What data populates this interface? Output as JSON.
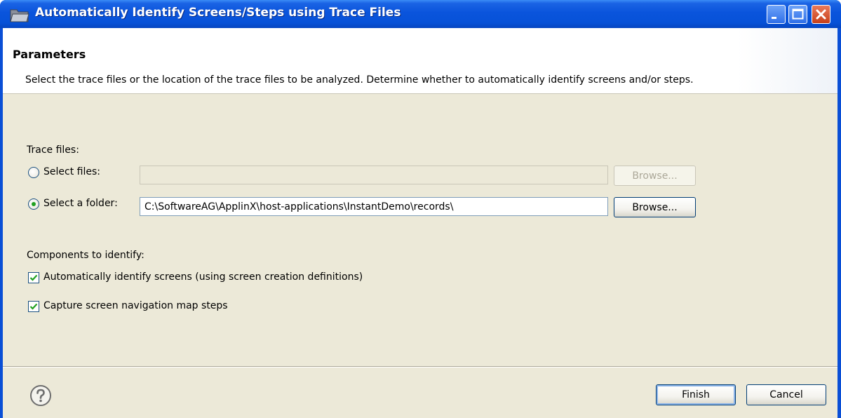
{
  "window": {
    "title": "Automatically Identify Screens/Steps using Trace Files",
    "colors": {
      "titlebar": "#0752d8",
      "close": "#c84019",
      "client": "#ece9d8"
    }
  },
  "header": {
    "title": "Parameters",
    "description": "Select the trace files or the location of the trace files to be analyzed. Determine whether to automatically identify screens and/or steps."
  },
  "trace_files": {
    "label": "Trace files:",
    "select_files": {
      "label": "Select files:",
      "selected": false,
      "value": "",
      "browse_label": "Browse..."
    },
    "select_folder": {
      "label": "Select a folder:",
      "selected": true,
      "value": "C:\\SoftwareAG\\ApplinX\\host-applications\\InstantDemo\\records\\",
      "browse_label": "Browse..."
    }
  },
  "components": {
    "label": "Components to identify:",
    "identify_screens": {
      "label": "Automatically identify screens (using screen creation definitions)",
      "checked": true
    },
    "capture_steps": {
      "label": "Capture screen navigation map steps",
      "checked": true
    }
  },
  "footer": {
    "help_icon": "question-mark-icon",
    "finish_label": "Finish",
    "cancel_label": "Cancel"
  }
}
